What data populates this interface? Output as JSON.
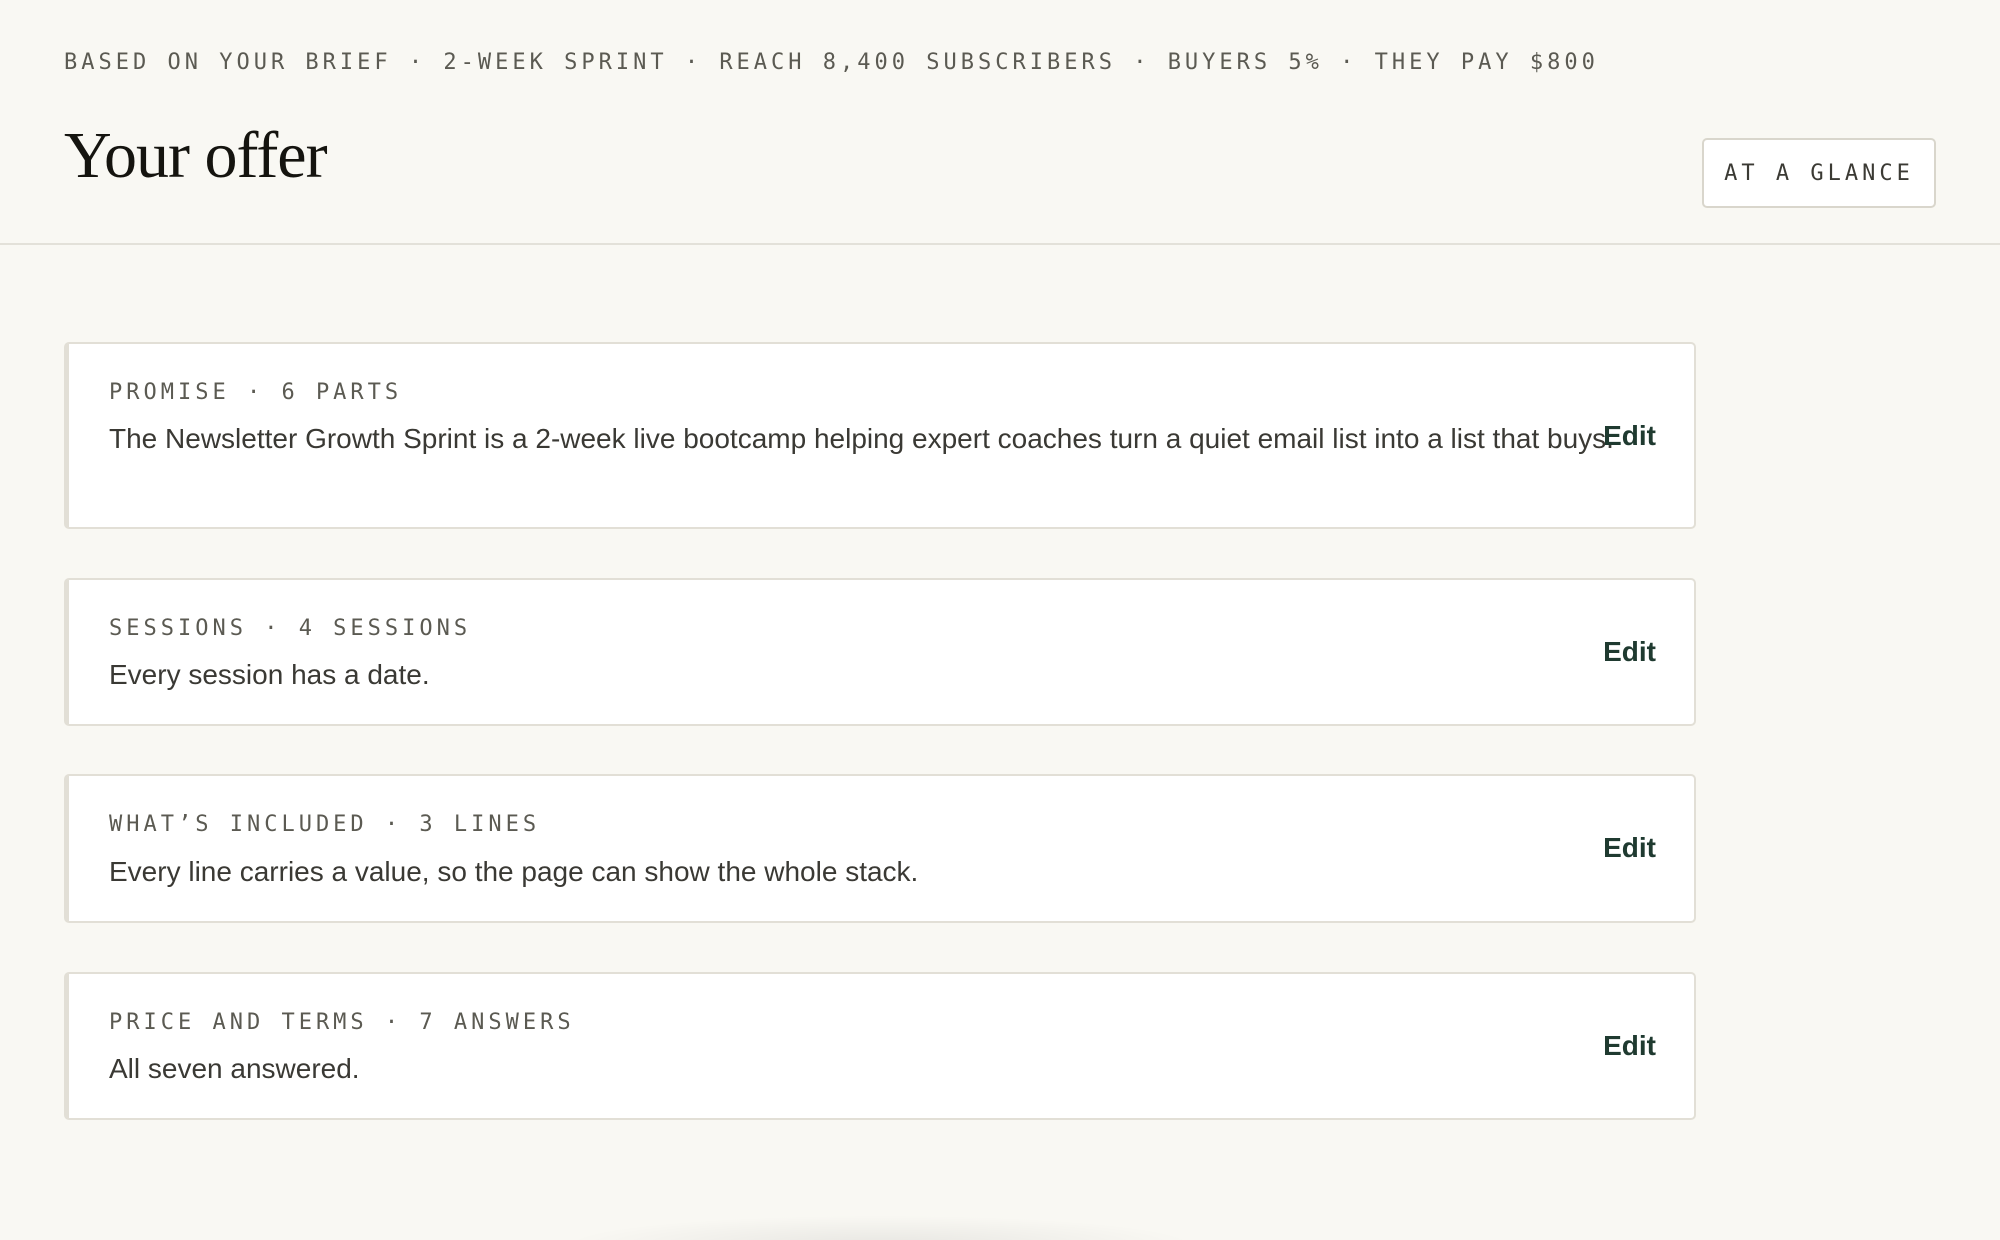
{
  "header": {
    "brief": "BASED ON YOUR BRIEF · 2-WEEK SPRINT · REACH 8,400 SUBSCRIBERS · BUYERS 5% · THEY PAY $800",
    "title": "Your offer",
    "glance_label": "AT A GLANCE"
  },
  "sections": [
    {
      "label": "PROMISE · 6 PARTS",
      "body": "The Newsletter Growth Sprint is a 2-week live bootcamp helping expert coaches turn a quiet email list into a list that buys.",
      "edit_label": "Edit"
    },
    {
      "label": "SESSIONS · 4 SESSIONS",
      "body": "Every session has a date.",
      "edit_label": "Edit"
    },
    {
      "label": "WHAT’S INCLUDED · 3 LINES",
      "body": "Every line carries a value, so the page can show the whole stack.",
      "edit_label": "Edit"
    },
    {
      "label": "PRICE AND TERMS · 7 ANSWERS",
      "body": "All seven answered.",
      "edit_label": "Edit"
    }
  ]
}
